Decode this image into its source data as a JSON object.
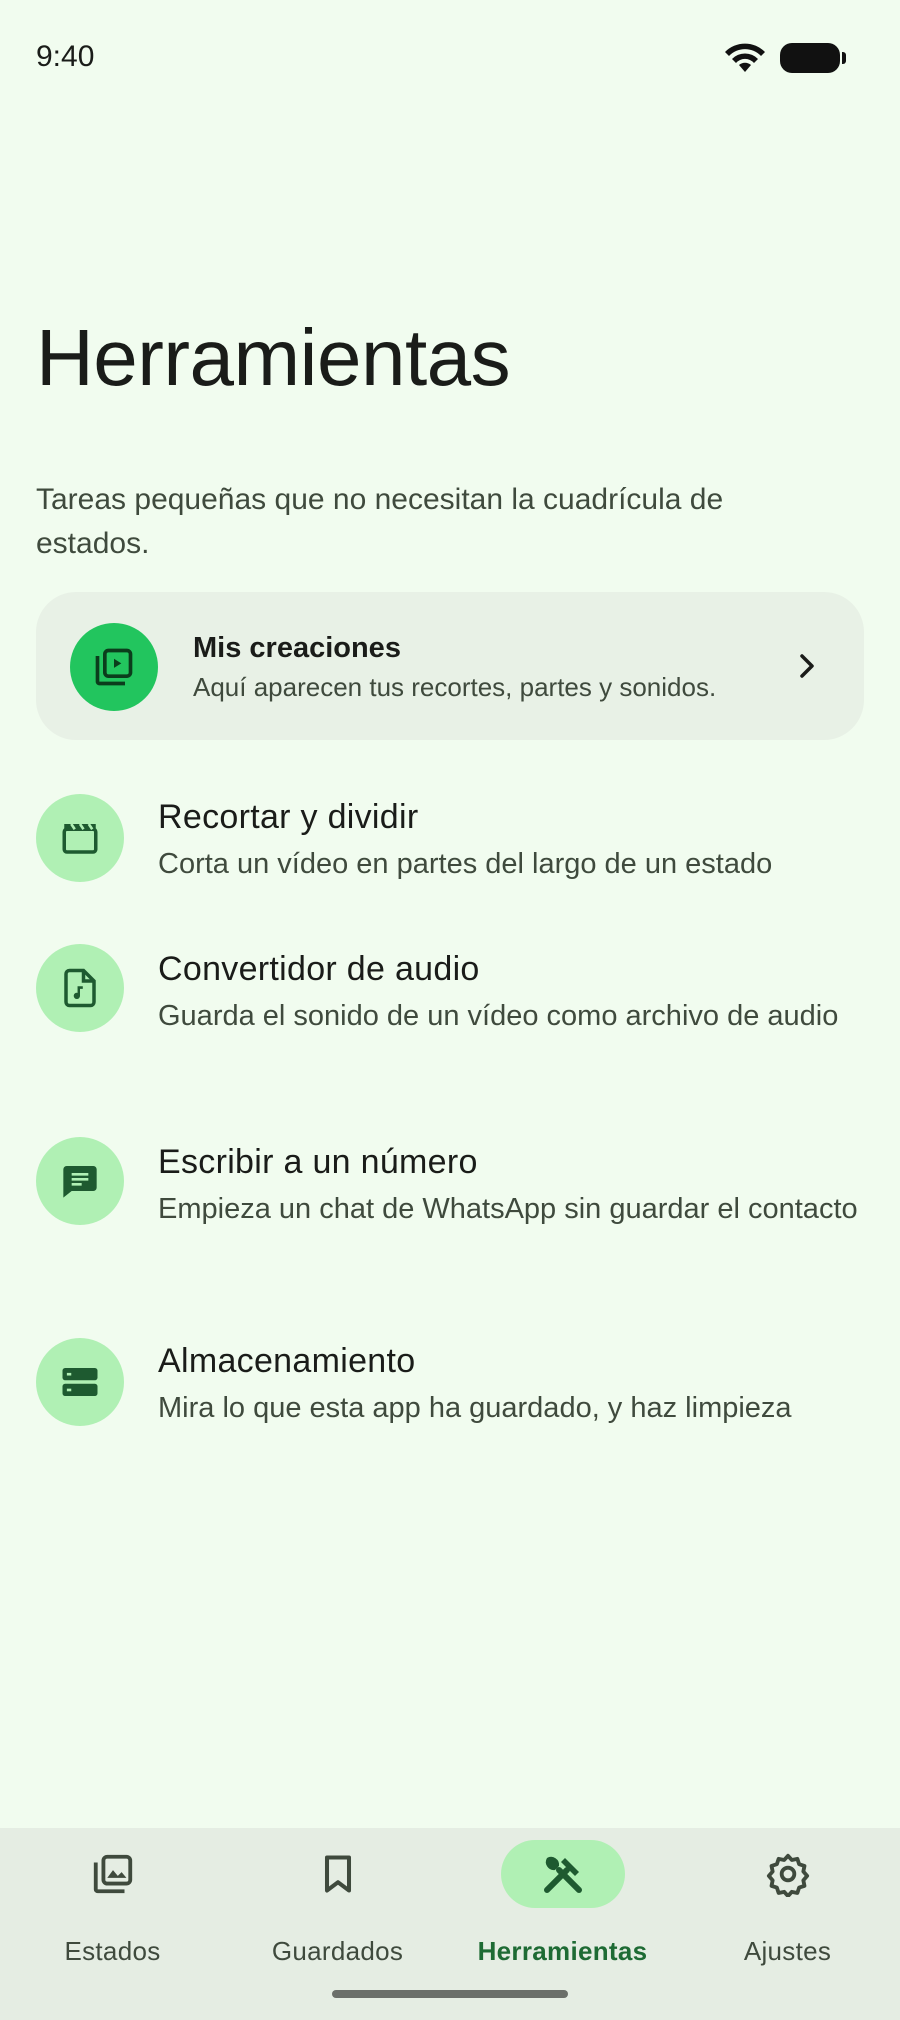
{
  "status": {
    "time": "9:40"
  },
  "header": {
    "title": "Herramientas",
    "subtitle": "Tareas pequeñas que no necesitan la cuadrícula de estados."
  },
  "creations": {
    "title": "Mis creaciones",
    "description": "Aquí aparecen tus recortes, partes y sonidos.",
    "icon": "video-library-icon"
  },
  "tools": [
    {
      "title": "Recortar y dividir",
      "description": "Corta un vídeo en partes del largo de un estado",
      "icon": "clapperboard-icon"
    },
    {
      "title": "Convertidor de audio",
      "description": "Guarda el sonido de un vídeo como archivo de audio",
      "icon": "audio-file-icon"
    },
    {
      "title": "Escribir a un número",
      "description": "Empieza un chat de WhatsApp sin guardar el contacto",
      "icon": "chat-icon"
    },
    {
      "title": "Almacenamiento",
      "description": "Mira lo que esta app ha guardado, y haz limpieza",
      "icon": "storage-icon"
    }
  ],
  "nav": [
    {
      "label": "Estados",
      "icon": "gallery-icon",
      "active": false
    },
    {
      "label": "Guardados",
      "icon": "bookmark-icon",
      "active": false
    },
    {
      "label": "Herramientas",
      "icon": "tools-icon",
      "active": true
    },
    {
      "label": "Ajustes",
      "icon": "settings-icon",
      "active": false
    }
  ],
  "colors": {
    "background": "#f1fcef",
    "accent": "#22c55e",
    "icon_bg": "#b0f0b4",
    "active_label": "#1e6b34"
  }
}
